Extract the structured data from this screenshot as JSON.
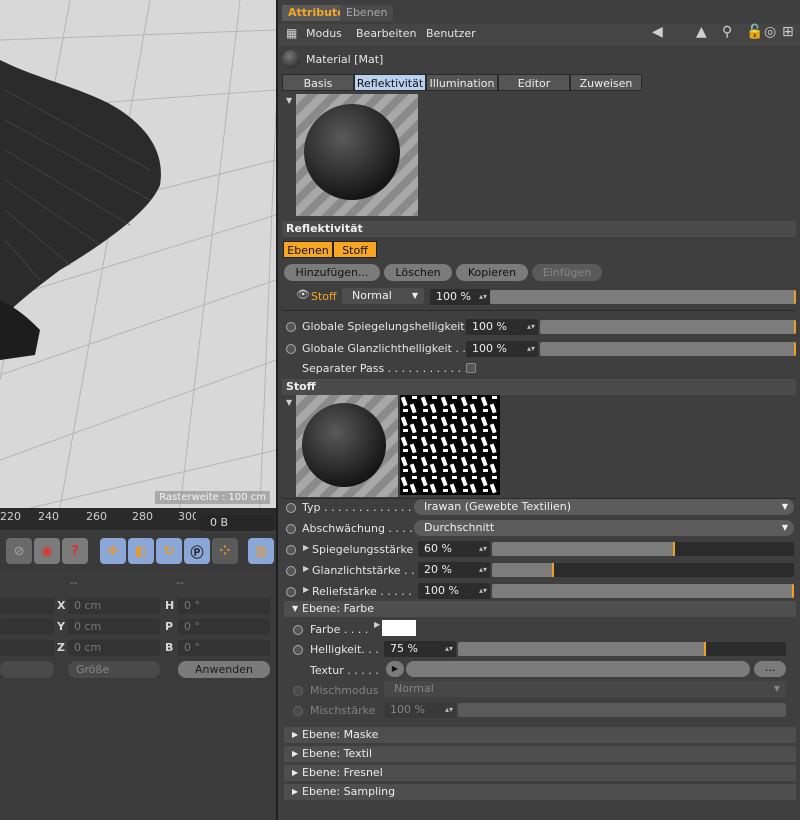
{
  "viewport": {
    "label": "Rasterweite : 100 cm"
  },
  "timeline": {
    "ticks": [
      "220",
      "240",
      "260",
      "280",
      "300"
    ],
    "frame": "0 B"
  },
  "toolbar_icons": [
    "no-entry-icon",
    "record-icon",
    "help-icon",
    "move-icon",
    "key-icon",
    "rotate-icon",
    "p-icon",
    "grid-icon",
    "film-icon"
  ],
  "coords": {
    "dash1": "--",
    "dash2": "--",
    "rows": [
      {
        "axis": "X",
        "value": "0 cm",
        "axis2": "H",
        "value2": "0 °"
      },
      {
        "axis": "Y",
        "value": "0 cm",
        "axis2": "P",
        "value2": "0 °"
      },
      {
        "axis": "Z",
        "value": "0 cm",
        "axis2": "B",
        "value2": "0 °"
      }
    ],
    "size_mode": "Größe",
    "apply": "Anwenden"
  },
  "tabs": {
    "attribute": "Attribute",
    "ebenen": "Ebenen"
  },
  "menus": {
    "modus": "Modus",
    "bearbeiten": "Bearbeiten",
    "benutzer": "Benutzer"
  },
  "material": {
    "title": "Material [Mat]"
  },
  "mat_tabs": [
    "Basis",
    "Reflektivität",
    "Illumination",
    "Editor",
    "Zuweisen"
  ],
  "reflect": {
    "header": "Reflektivität",
    "sub_tabs": [
      "Ebenen",
      "Stoff"
    ],
    "buttons": {
      "add": "Hinzufügen...",
      "delete": "Löschen",
      "copy": "Kopieren",
      "paste": "Einfügen"
    },
    "layer": {
      "name": "Stoff",
      "mode": "Normal",
      "value": "100 %",
      "level": 1.0
    },
    "global_spec": {
      "label": "Globale Spiegelungshelligkeit",
      "value": "100 %",
      "level": 1.0
    },
    "global_gloss": {
      "label": "Globale Glanzlichthelligkeit . .",
      "value": "100 %",
      "level": 1.0
    },
    "separate_pass": "Separater Pass . . . . . . . . . . . ."
  },
  "stoff": {
    "header": "Stoff",
    "typ": {
      "label": "Typ . . . . . . . . . . . . . . . . . .",
      "value": "Irawan (Gewebte Textilien)"
    },
    "abschwaechung": {
      "label": "Abschwächung . . . . .",
      "value": "Durchschnitt"
    },
    "spiegelung": {
      "label": "Spiegelungsstärke . .",
      "value": "60 %",
      "level": 0.6
    },
    "glanz": {
      "label": "Glanzlichtstärke . .",
      "value": "20 %",
      "level": 0.2
    },
    "relief": {
      "label": "Reliefstärke . . . . .",
      "value": "100 %",
      "level": 1.0
    }
  },
  "farbe_layer": {
    "header": "Ebene: Farbe",
    "farbe": {
      "label": "Farbe . . . .",
      "color": "#ffffff"
    },
    "helligkeit": {
      "label": "Helligkeit. . .",
      "value": "75 %",
      "level": 0.75
    },
    "textur": {
      "label": "Textur . . . . .",
      "more": "..."
    },
    "mischmodus": {
      "label": "Mischmodus",
      "value": "Normal"
    },
    "mischstaerke": {
      "label": "Mischstärke",
      "value": "100 %"
    }
  },
  "collapsed_layers": [
    "Ebene: Maske",
    "Ebene: Textil",
    "Ebene: Fresnel",
    "Ebene: Sampling"
  ],
  "colors": {
    "accent": "#f6a623",
    "active_tab": "#b9d0ee"
  }
}
